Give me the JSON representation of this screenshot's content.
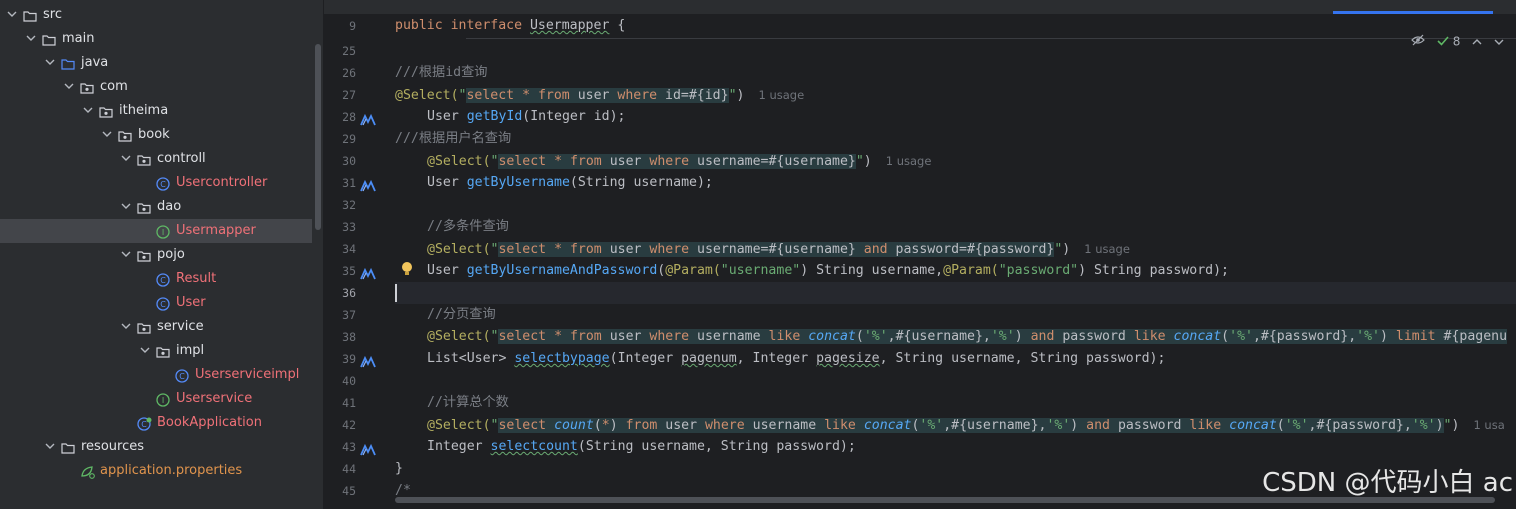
{
  "tree": {
    "items": [
      {
        "label": "src",
        "type": "folder"
      },
      {
        "label": "main",
        "type": "folder"
      },
      {
        "label": "java",
        "type": "folder-blue"
      },
      {
        "label": "com",
        "type": "package"
      },
      {
        "label": "itheima",
        "type": "package"
      },
      {
        "label": "book",
        "type": "package"
      },
      {
        "label": "controll",
        "type": "package"
      },
      {
        "label": "Usercontroller",
        "type": "class"
      },
      {
        "label": "dao",
        "type": "package"
      },
      {
        "label": "Usermapper",
        "type": "interface"
      },
      {
        "label": "pojo",
        "type": "package"
      },
      {
        "label": "Result",
        "type": "class"
      },
      {
        "label": "User",
        "type": "class"
      },
      {
        "label": "service",
        "type": "package"
      },
      {
        "label": "impl",
        "type": "package"
      },
      {
        "label": "Userserviceimpl",
        "type": "class"
      },
      {
        "label": "Userservice",
        "type": "interface"
      },
      {
        "label": "BookApplication",
        "type": "spring-class"
      },
      {
        "label": "resources",
        "type": "folder"
      },
      {
        "label": "application.properties",
        "type": "properties"
      }
    ]
  },
  "editor": {
    "inspection_count": "8",
    "usage_label": "1 usage",
    "usage_label_clipped": "1 usa",
    "line_numbers": [
      "9",
      "25",
      "26",
      "27",
      "28",
      "29",
      "30",
      "31",
      "32",
      "33",
      "34",
      "35",
      "36",
      "37",
      "38",
      "39",
      "40",
      "41",
      "42",
      "43",
      "44",
      "45"
    ],
    "code": {
      "l9": {
        "kw": "public interface ",
        "name": "Usermapper",
        " rest": " {"
      },
      "l26": "///根据id查询",
      "l27": {
        "ann": "@Select(",
        "q1": "\"",
        "sql_a": "select * from ",
        "tbl": "user ",
        "sql_b": "where ",
        "p": "id=#{id}",
        "q2": "\"",
        ")": ")"
      },
      "l28": {
        "type": "User ",
        "meth": "getById",
        "args": "(Integer id);"
      },
      "l29": "///根据用户名查询",
      "l30": {
        "ann": "@Select(",
        "sql": "select * from user where username=#{username}",
        "close": "\")"
      },
      "l31": {
        "type": "User ",
        "meth": "getByUsername",
        "args": "(String username);"
      },
      "l33": "//多条件查询",
      "l34": {
        "ann": "@Select(",
        "sql": "select * from user where username=#{username} and password=#{password}",
        "close": "\")"
      },
      "l35": {
        "type": "User ",
        "meth": "getByUsernameAndPassword",
        "a1": "(",
        "p1ann": "@Param(",
        "p1str": "\"username\"",
        "p1rest": ") String username,",
        "p2ann": "@Param(",
        "p2str": "\"password\"",
        "p2rest": ") String password);"
      },
      "l37": "//分页查询",
      "l38": {
        "ann": "@Select(",
        "sql": "select * from user where username like concat('%',#{username},'%') and password like concat('%',#{password},'%') limit #{pagenu"
      },
      "l39": {
        "type": "List<User> ",
        "meth": "selectbypage",
        "args_a": "(Integer ",
        "pn": "pagenum",
        "args_b": ", Integer ",
        "ps": "pagesize",
        "args_c": ", String username, String password);"
      },
      "l41": "//计算总个数",
      "l42": {
        "ann": "@Select(",
        "sql": "select count(*) from user where username like concat('%',#{username},'%') and password like concat('%',#{password},'%')",
        "close": "\")"
      },
      "l43": {
        "type": "Integer ",
        "meth": "selectcount",
        "args": "(String username, String password);"
      },
      "l44": "}",
      "l45": "/*"
    }
  },
  "watermark": "CSDN @代码小白 ac"
}
